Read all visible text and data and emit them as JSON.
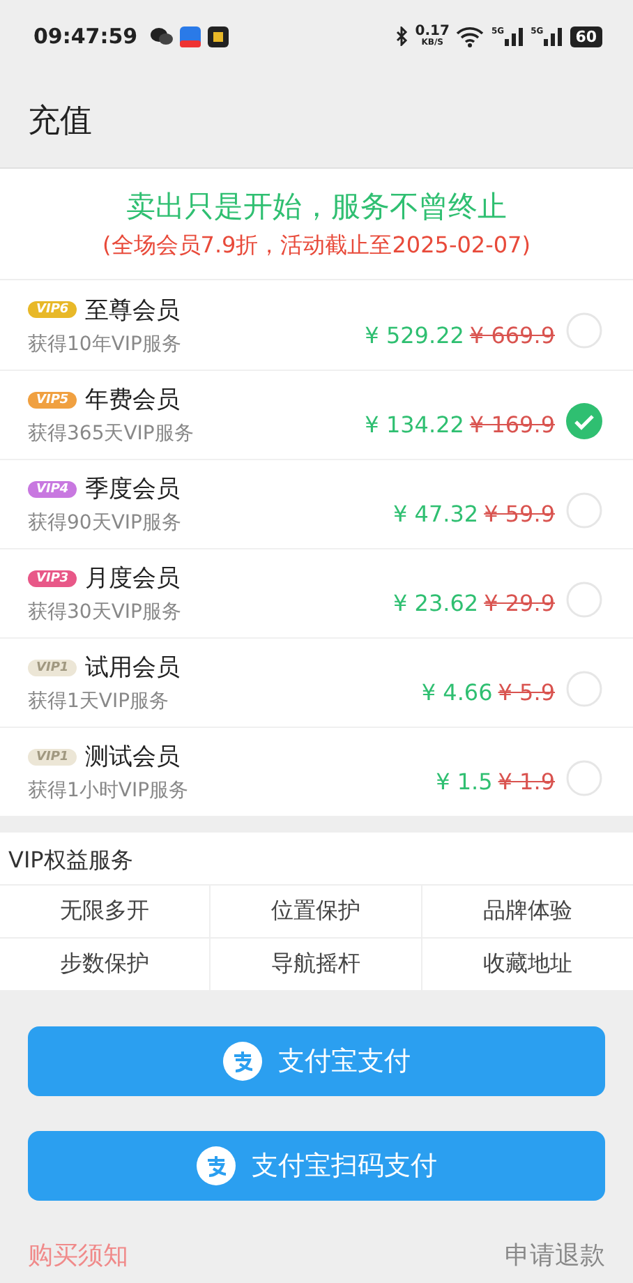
{
  "status_bar": {
    "time": "09:47:59",
    "net_speed": "0.17",
    "net_unit": "KB/S",
    "signals": [
      {
        "label": "5G"
      },
      {
        "label": "5G"
      }
    ],
    "battery": "60"
  },
  "header": {
    "title": "充值"
  },
  "banner": {
    "headline": "卖出只是开始，服务不曾终止",
    "notice": "(全场会员7.9折，活动截止至2025-02-07)"
  },
  "plans": [
    {
      "badge": "VIP6",
      "color": "#e8b828",
      "name": "至尊会员",
      "desc": "获得10年VIP服务",
      "price": "¥ 529.22",
      "original": "¥ 669.9",
      "selected": false
    },
    {
      "badge": "VIP5",
      "color": "#f0a040",
      "name": "年费会员",
      "desc": "获得365天VIP服务",
      "price": "¥ 134.22",
      "original": "¥ 169.9",
      "selected": true
    },
    {
      "badge": "VIP4",
      "color": "#c878e0",
      "name": "季度会员",
      "desc": "获得90天VIP服务",
      "price": "¥ 47.32",
      "original": "¥ 59.9",
      "selected": false
    },
    {
      "badge": "VIP3",
      "color": "#e85888",
      "name": "月度会员",
      "desc": "获得30天VIP服务",
      "price": "¥ 23.62",
      "original": "¥ 29.9",
      "selected": false
    },
    {
      "badge": "VIP1",
      "color": "#ece6d6",
      "name": "试用会员",
      "desc": "获得1天VIP服务",
      "price": "¥ 4.66",
      "original": "¥ 5.9",
      "selected": false
    },
    {
      "badge": "VIP1",
      "color": "#ece6d6",
      "name": "测试会员",
      "desc": "获得1小时VIP服务",
      "price": "¥ 1.5",
      "original": "¥ 1.9",
      "selected": false
    }
  ],
  "benefits": {
    "title": "VIP权益服务",
    "items": [
      "无限多开",
      "位置保护",
      "品牌体验",
      "步数保护",
      "导航摇杆",
      "收藏地址"
    ]
  },
  "buttons": [
    "支付宝支付",
    "支付宝扫码支付"
  ],
  "footer": {
    "notice_link": "购买须知",
    "refund_link": "申请退款"
  }
}
